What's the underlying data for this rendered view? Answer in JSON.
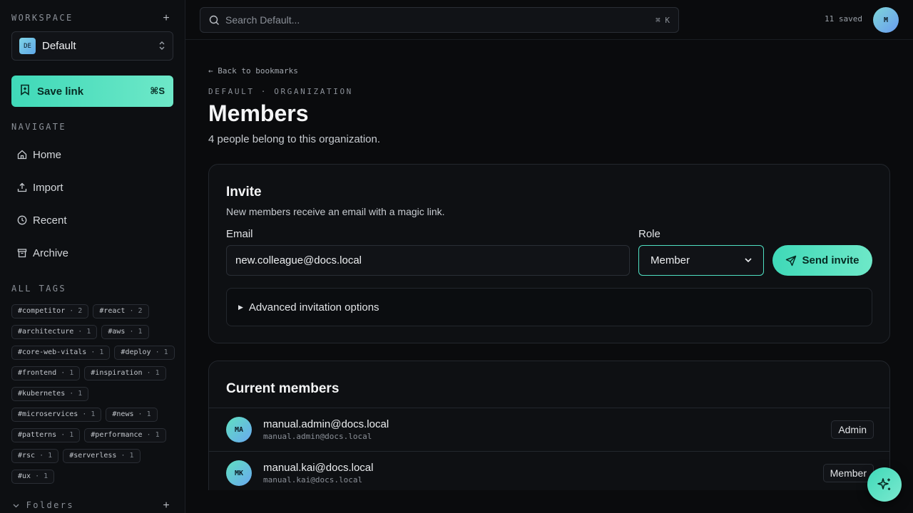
{
  "sidebar": {
    "workspace_label": "WORKSPACE",
    "workspace": {
      "badge": "DE",
      "name": "Default"
    },
    "save_link": {
      "label": "Save link",
      "shortcut": "⌘S"
    },
    "navigate_label": "NAVIGATE",
    "nav": [
      {
        "label": "Home",
        "icon": "home-icon"
      },
      {
        "label": "Import",
        "icon": "upload-icon"
      },
      {
        "label": "Recent",
        "icon": "clock-icon"
      },
      {
        "label": "Archive",
        "icon": "archive-icon"
      }
    ],
    "tags_label": "ALL TAGS",
    "tags": [
      {
        "name": "#competitor",
        "count": "2"
      },
      {
        "name": "#react",
        "count": "2"
      },
      {
        "name": "#architecture",
        "count": "1"
      },
      {
        "name": "#aws",
        "count": "1"
      },
      {
        "name": "#core-web-vitals",
        "count": "1"
      },
      {
        "name": "#deploy",
        "count": "1"
      },
      {
        "name": "#frontend",
        "count": "1"
      },
      {
        "name": "#inspiration",
        "count": "1"
      },
      {
        "name": "#kubernetes",
        "count": "1"
      },
      {
        "name": "#microservices",
        "count": "1"
      },
      {
        "name": "#news",
        "count": "1"
      },
      {
        "name": "#patterns",
        "count": "1"
      },
      {
        "name": "#performance",
        "count": "1"
      },
      {
        "name": "#rsc",
        "count": "1"
      },
      {
        "name": "#serverless",
        "count": "1"
      },
      {
        "name": "#ux",
        "count": "1"
      }
    ],
    "folders_label": "Folders"
  },
  "topbar": {
    "search_placeholder": "Search Default...",
    "search_shortcut": "⌘ K",
    "saved_count": "11 saved",
    "avatar": "M"
  },
  "main": {
    "back": "Back to bookmarks",
    "eyebrow": "DEFAULT · ORGANIZATION",
    "title": "Members",
    "subtitle": "4 people belong to this organization.",
    "invite": {
      "title": "Invite",
      "description": "New members receive an email with a magic link.",
      "email_label": "Email",
      "email_value": "new.colleague@docs.local",
      "role_label": "Role",
      "role_value": "Member",
      "send_label": "Send invite",
      "advanced_label": "Advanced invitation options"
    },
    "members": {
      "title": "Current members",
      "rows": [
        {
          "initials": "MA",
          "name": "manual.admin@docs.local",
          "email": "manual.admin@docs.local",
          "role": "Admin"
        },
        {
          "initials": "MK",
          "name": "manual.kai@docs.local",
          "email": "manual.kai@docs.local",
          "role": "Member"
        }
      ]
    }
  },
  "colors": {
    "accent": "#3fd9b8",
    "background": "#0a0b0d",
    "card": "#0e1013"
  }
}
